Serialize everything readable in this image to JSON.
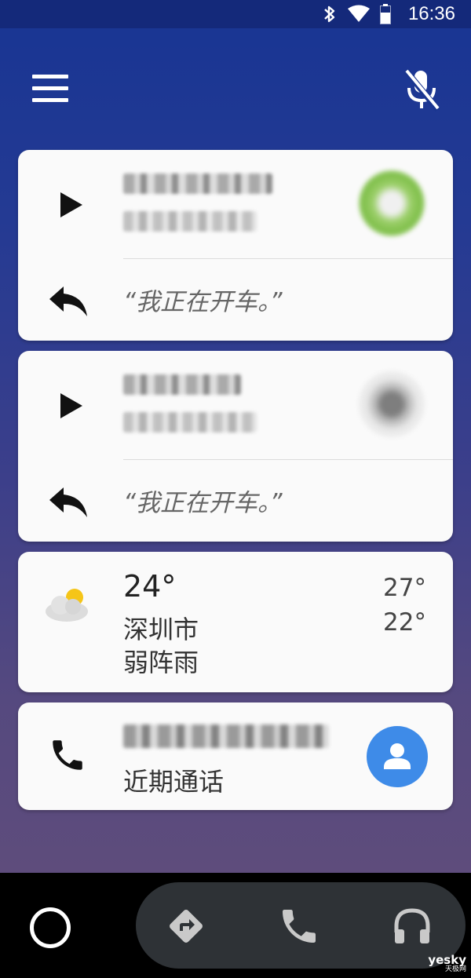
{
  "status_bar": {
    "time": "16:36",
    "icons": [
      "bluetooth-icon",
      "wifi-icon",
      "battery-icon"
    ]
  },
  "top_bar": {
    "menu_icon": "hamburger-menu-icon",
    "mic_icon": "mic-off-icon"
  },
  "messages": [
    {
      "sender_name": "",
      "preview": "",
      "avatar": "contact-avatar-blurred",
      "reply_text": "“我正在开车。”"
    },
    {
      "sender_name": "",
      "preview": "",
      "avatar": "contact-avatar-blurred",
      "reply_text": "“我正在开车。”"
    }
  ],
  "weather": {
    "icon": "partly-cloudy-icon",
    "current_temp": "24°",
    "city": "深圳市",
    "condition": "弱阵雨",
    "high": "27°",
    "low": "22°"
  },
  "recent_call": {
    "number": "",
    "label": "近期通话",
    "icon": "phone-icon",
    "avatar_icon": "person-icon"
  },
  "nav_bar": {
    "home": "home-circle-icon",
    "items": [
      "directions-icon",
      "phone-icon",
      "headphones-icon"
    ]
  },
  "watermark": {
    "brand": "yesky",
    "sub": "天极网"
  },
  "colors": {
    "accent_blue": "#3e8be8",
    "weather_sun": "#f5c518",
    "gradient_top": "#183593",
    "gradient_bottom": "#5e4c7c"
  }
}
